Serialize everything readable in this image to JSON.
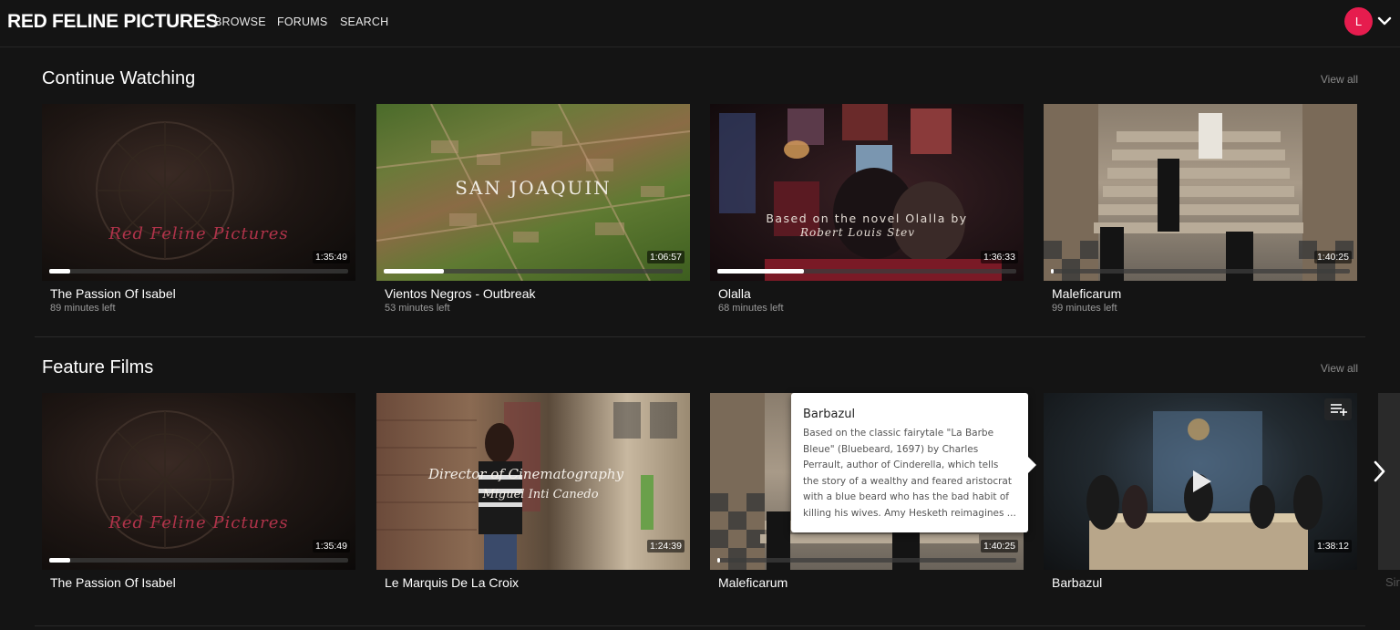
{
  "header": {
    "logo": "RED FELINE PICTURES",
    "nav": [
      "BROWSE",
      "FORUMS",
      "SEARCH"
    ],
    "avatar_initial": "L",
    "avatar_color": "#e61c4e"
  },
  "sections": [
    {
      "title": "Continue Watching",
      "view_all": "View all",
      "cards": [
        {
          "title": "The Passion Of Isabel",
          "subtitle": "89 minutes left",
          "duration": "1:35:49",
          "overlay": "Red Feline Pictures",
          "progress": 0.07
        },
        {
          "title": "Vientos Negros - Outbreak",
          "subtitle": "53 minutes left",
          "duration": "1:06:57",
          "overlay": "SAN JOAQUIN",
          "progress": 0.2
        },
        {
          "title": "Olalla",
          "subtitle": "68 minutes left",
          "duration": "1:36:33",
          "overlay": "Based on the novel Olalla by",
          "overlay2": "Robert Louis Stev",
          "progress": 0.29
        },
        {
          "title": "Maleficarum",
          "subtitle": "99 minutes left",
          "duration": "1:40:25",
          "progress": 0.01
        }
      ]
    },
    {
      "title": "Feature Films",
      "view_all": "View all",
      "cards": [
        {
          "title": "The Passion Of Isabel",
          "duration": "1:35:49",
          "overlay": "Red Feline Pictures",
          "progress": 0.07
        },
        {
          "title": "Le Marquis De La Croix",
          "duration": "1:24:39",
          "overlay": "Director of Cinematography",
          "overlay2": "Miguel Inti Canedo"
        },
        {
          "title": "Maleficarum",
          "duration": "1:40:25",
          "progress": 0.01
        },
        {
          "title": "Barbazul",
          "duration": "1:38:12"
        }
      ],
      "peek_title": "Sir"
    }
  ],
  "tooltip": {
    "title": "Barbazul",
    "description": "Based on the classic fairytale \"La Barbe Bleue\" (Bluebeard, 1697) by Charles Perrault, author of Cinderella, which tells the story of a wealthy and feared aristocrat with a blue beard who has the bad habit of killing his wives. Amy Hesketh reimagines ..."
  },
  "icons": {
    "caret": "chevron-down-icon",
    "next": "chevron-right-icon",
    "queue": "playlist-add-icon",
    "play": "play-icon"
  }
}
